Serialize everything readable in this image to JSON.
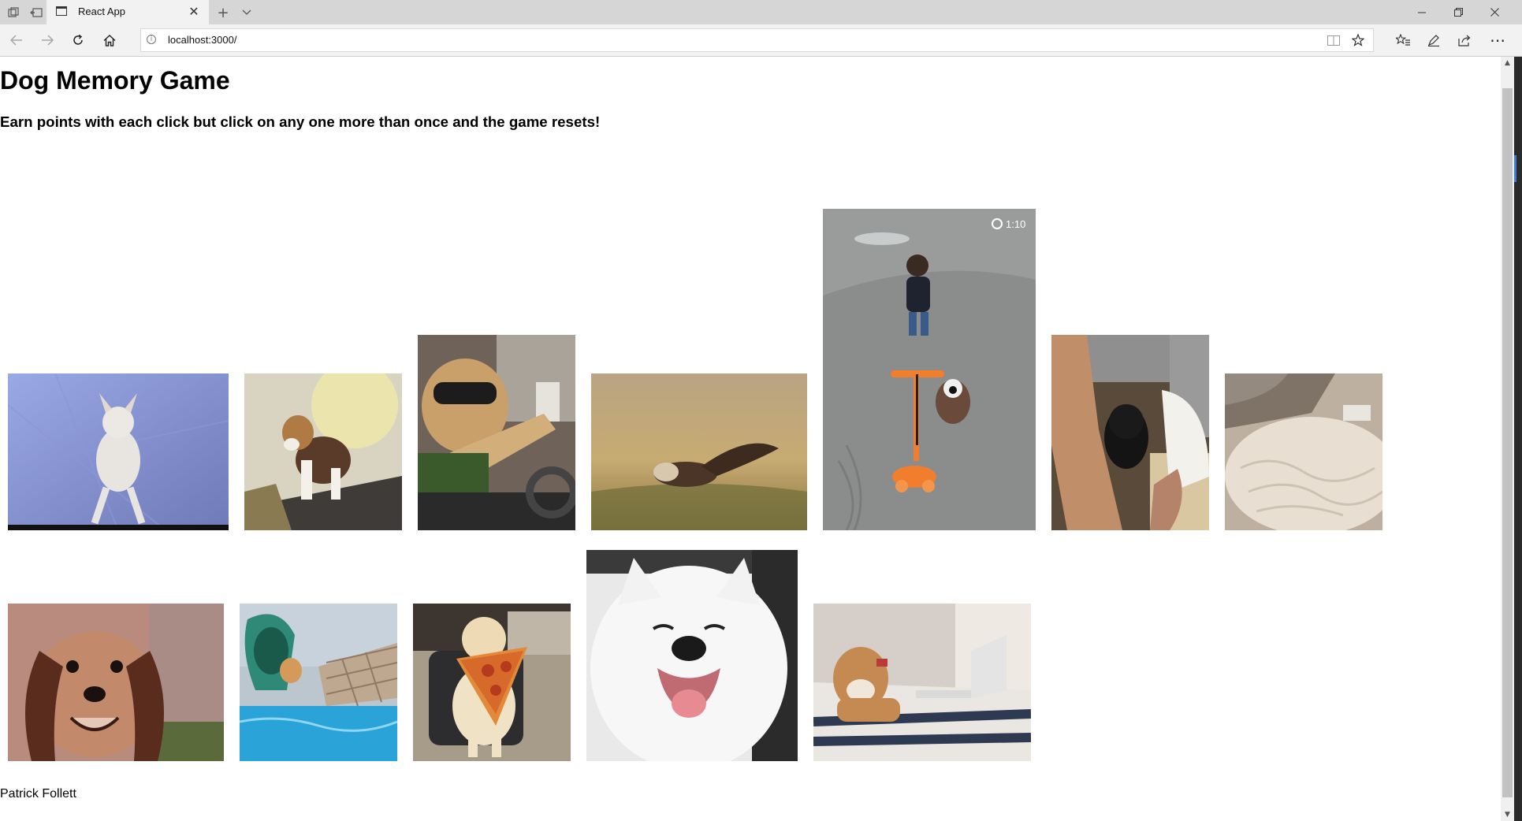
{
  "browser": {
    "tab_title": "React App",
    "url": "localhost:3000/"
  },
  "page": {
    "title": "Dog Memory Game",
    "subtitle": "Earn points with each click but click on any one more than once and the game resets!",
    "footer": "Patrick Follett"
  },
  "dog_images": [
    {
      "name": "dog-image-chihuahua-dancing",
      "subject": "chihuahua dancing on hind legs"
    },
    {
      "name": "dog-image-beagle-treadmill",
      "subject": "beagle on treadmill"
    },
    {
      "name": "dog-image-golden-driving",
      "subject": "golden retriever with goggles driving"
    },
    {
      "name": "dog-image-basset-running",
      "subject": "basset hound running in field"
    },
    {
      "name": "dog-image-toddler-scooter-dog",
      "subject": "toddler and dog with scooter",
      "overlay_text": "1:10"
    },
    {
      "name": "dog-image-black-dog-kitchen",
      "subject": "black dog in kitchen"
    },
    {
      "name": "dog-image-fluffy-rug",
      "subject": "fluffy white rug"
    },
    {
      "name": "dog-image-dachshund-smiling",
      "subject": "dachshund smiling"
    },
    {
      "name": "dog-image-pool-slide",
      "subject": "dog on pool slide"
    },
    {
      "name": "dog-image-pizza-bib",
      "subject": "dog wearing pizza bib"
    },
    {
      "name": "dog-image-samoyed",
      "subject": "samoyed smiling"
    },
    {
      "name": "dog-image-shiba-laptop",
      "subject": "shiba inu with laptop"
    }
  ],
  "colors": {
    "titlebar": "#d6d6d6",
    "navbar": "#f2f2f2",
    "page_background": "#ffffff",
    "text": "#000000"
  }
}
